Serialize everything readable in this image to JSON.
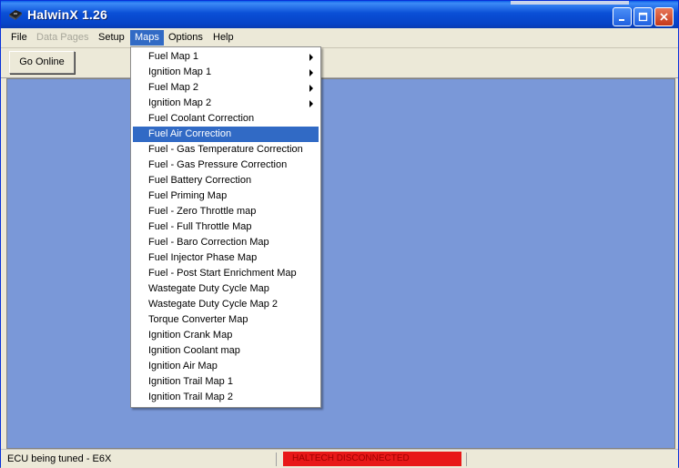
{
  "window": {
    "title": "HalwinX 1.26",
    "icon": "app-icon"
  },
  "title_buttons": [
    "minimize-button",
    "maximize-button",
    "close-button"
  ],
  "menubar": {
    "items": [
      {
        "label": "File",
        "state": "normal"
      },
      {
        "label": "Data Pages",
        "state": "disabled"
      },
      {
        "label": "Setup",
        "state": "normal"
      },
      {
        "label": "Maps",
        "state": "active"
      },
      {
        "label": "Options",
        "state": "normal"
      },
      {
        "label": "Help",
        "state": "normal"
      }
    ]
  },
  "toolbar": {
    "go_online_label": "Go Online"
  },
  "maps_menu": {
    "items": [
      {
        "label": "Fuel Map 1",
        "submenu": true
      },
      {
        "label": "Ignition Map 1",
        "submenu": true
      },
      {
        "label": "Fuel Map 2",
        "submenu": true
      },
      {
        "label": "Ignition Map 2",
        "submenu": true
      },
      {
        "label": "Fuel Coolant Correction"
      },
      {
        "label": "Fuel Air Correction",
        "highlighted": true
      },
      {
        "label": "Fuel - Gas Temperature Correction"
      },
      {
        "label": "Fuel - Gas Pressure Correction"
      },
      {
        "label": "Fuel Battery Correction"
      },
      {
        "label": "Fuel Priming Map"
      },
      {
        "label": "Fuel - Zero Throttle map"
      },
      {
        "label": "Fuel - Full Throttle Map"
      },
      {
        "label": "Fuel - Baro Correction Map"
      },
      {
        "label": "Fuel Injector Phase Map"
      },
      {
        "label": "Fuel - Post Start Enrichment Map"
      },
      {
        "label": "Wastegate Duty Cycle Map"
      },
      {
        "label": "Wastegate Duty Cycle Map 2"
      },
      {
        "label": "Torque Converter Map"
      },
      {
        "label": "Ignition Crank Map"
      },
      {
        "label": "Ignition Coolant map"
      },
      {
        "label": "Ignition Air Map"
      },
      {
        "label": "Ignition Trail Map 1"
      },
      {
        "label": "Ignition Trail Map 2"
      }
    ]
  },
  "statusbar": {
    "left": "ECU being tuned - E6X",
    "connection": "HALTECH DISCONNECTED",
    "connection_color": "#e81818"
  }
}
